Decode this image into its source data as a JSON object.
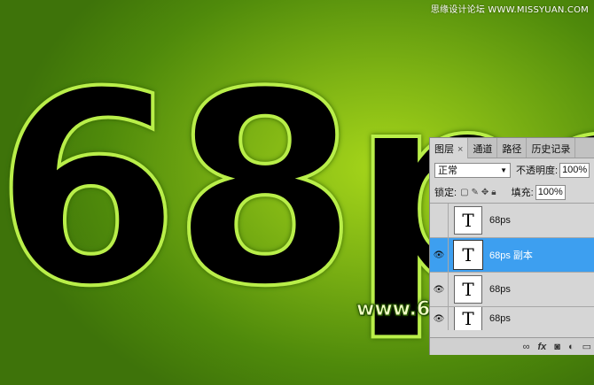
{
  "canvas": {
    "big_text": "68ps"
  },
  "watermarks": {
    "top": "思缘设计论坛 WWW.MISSYUAN.COM",
    "bottom": "www.68ps.com"
  },
  "layers_panel": {
    "tabs": [
      {
        "label": "图层",
        "close": "×"
      },
      {
        "label": "通道"
      },
      {
        "label": "路径"
      },
      {
        "label": "历史记录"
      }
    ],
    "blend_mode": "正常",
    "opacity_label": "不透明度:",
    "opacity_value": "100%",
    "lock_label": "锁定:",
    "fill_label": "填充:",
    "fill_value": "100%",
    "layers": [
      {
        "thumb": "T",
        "name": "68ps",
        "visible": false,
        "selected": false
      },
      {
        "thumb": "T",
        "name": "68ps 副本",
        "visible": true,
        "selected": true
      },
      {
        "thumb": "T",
        "name": "68ps",
        "visible": true,
        "selected": false
      },
      {
        "thumb": "T",
        "name": "68ps",
        "visible": true,
        "selected": false
      }
    ],
    "footer_icons": [
      "link-icon",
      "fx-icon",
      "mask-icon",
      "adjustment-icon",
      "folder-icon"
    ]
  },
  "colors": {
    "background_center": "#a6d61a",
    "background_edge": "#3e730a",
    "selected_layer": "#3d9ff0"
  }
}
